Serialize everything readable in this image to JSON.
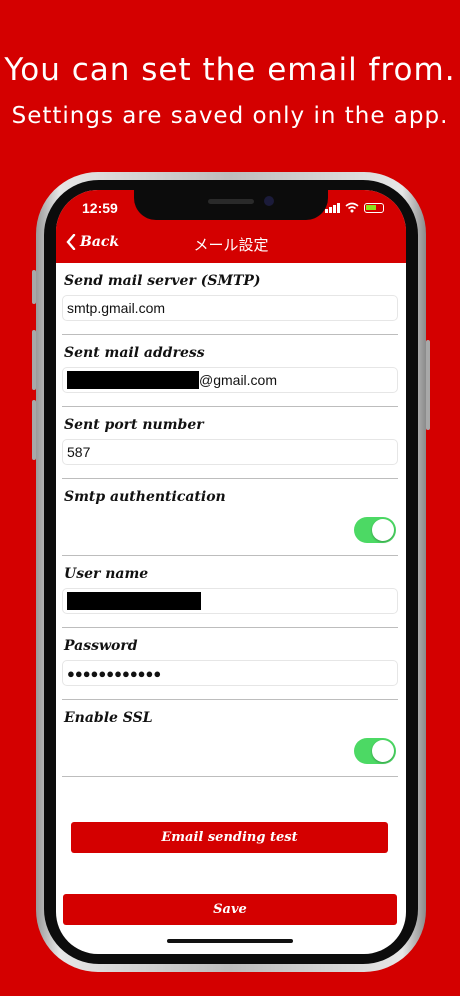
{
  "promo": {
    "line1": "You can set the email from.",
    "line2": "Settings are saved only in the app."
  },
  "status_bar": {
    "time": "12:59"
  },
  "nav": {
    "back_label": "Back",
    "title": "メール設定"
  },
  "form": {
    "smtp_server": {
      "label": "Send mail server (SMTP)",
      "value": "smtp.gmail.com"
    },
    "sent_address": {
      "label": "Sent mail address",
      "value_suffix": "@gmail.com"
    },
    "port": {
      "label": "Sent port number",
      "value": "587"
    },
    "smtp_auth": {
      "label": "Smtp authentication",
      "enabled": true
    },
    "user_name": {
      "label": "User name"
    },
    "password": {
      "label": "Password",
      "value": "●●●●●●●●●●●●"
    },
    "ssl": {
      "label": "Enable SSL",
      "enabled": true
    }
  },
  "buttons": {
    "test_label": "Email sending test",
    "save_label": "Save"
  },
  "colors": {
    "brand": "#d40000",
    "toggle_on": "#4cd964"
  }
}
